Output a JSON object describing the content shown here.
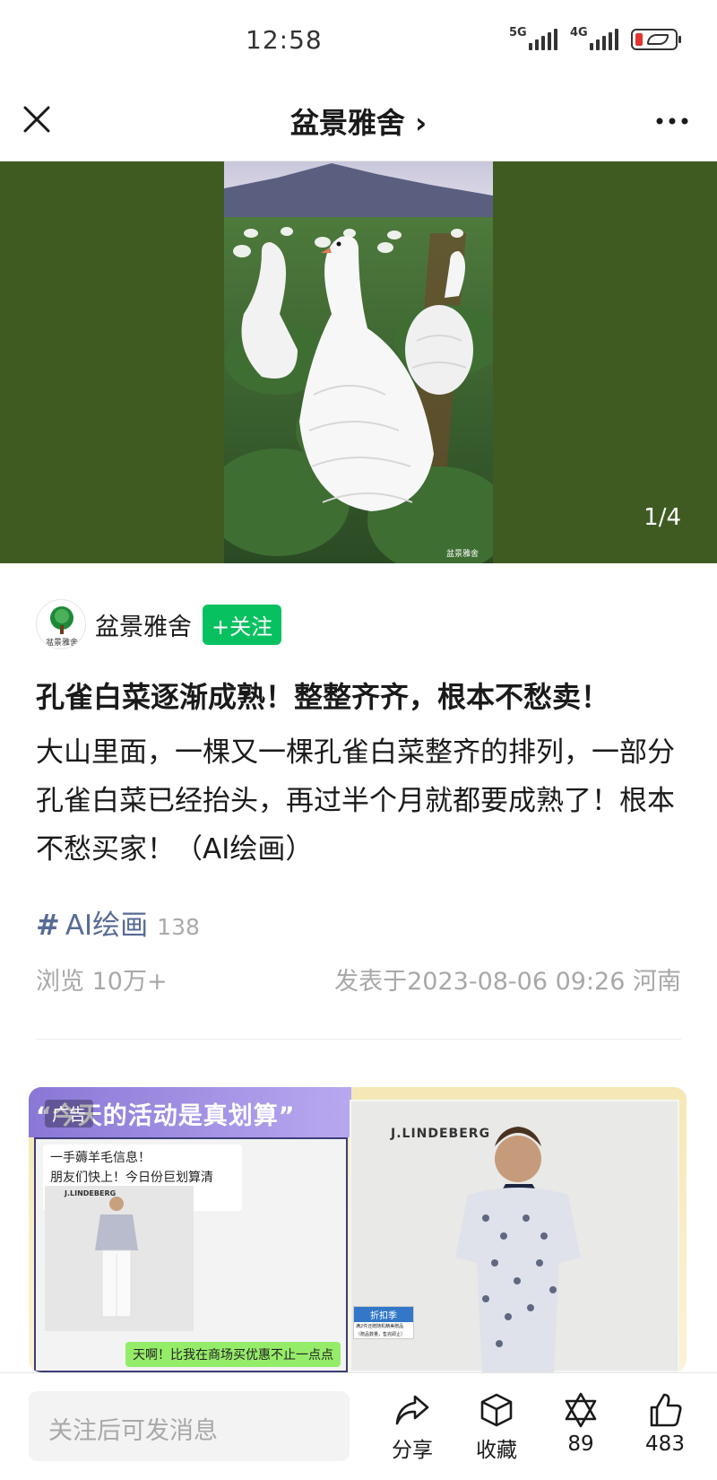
{
  "status_bar": {
    "time": "12:58",
    "network_1": "5G",
    "network_2": "4G"
  },
  "header": {
    "title": "盆景雅舍 ›",
    "close_icon": "close-icon",
    "more_icon": "more-icon"
  },
  "hero": {
    "page_indicator": "1/4",
    "watermark": "盆景雅舍"
  },
  "author": {
    "name": "盆景雅舍",
    "follow_label": "+关注",
    "avatar_text": "盆景雅舍"
  },
  "post": {
    "title": "孔雀白菜逐渐成熟！整整齐齐，根本不愁卖！",
    "body": "大山里面，一棵又一棵孔雀白菜整齐的排列，一部分孔雀白菜已经抬头，再过半个月就都要成熟了！根本不愁买家！（AI绘画）",
    "hashtag": "AI绘画",
    "hashtag_count": "138",
    "views": "浏览 10万+",
    "published": "发表于2023-08-06 09:26  河南"
  },
  "ad": {
    "headline": "“今天的活动是真划算”",
    "tag": "广告",
    "bubble_line_1": "一手薅羊毛信息！",
    "bubble_line_2": "朋友们快上！今日份巨划算清单：",
    "brand": "J.LINDEBERG",
    "green_bubble": "天啊！比我在商场买优惠不止一点点",
    "badge_title": "折扣季",
    "badge_line": "满2件还赠随机精美赠品",
    "badge_line_2": "（赠品数量，售完即止）"
  },
  "bottom_bar": {
    "message_placeholder": "关注后可发消息",
    "share_label": "分享",
    "favorite_label": "收藏",
    "wow_count": "89",
    "like_count": "483"
  },
  "colors": {
    "accent_green": "#07c160",
    "link_blue": "#576b95",
    "hero_bg": "#3f5b22"
  }
}
